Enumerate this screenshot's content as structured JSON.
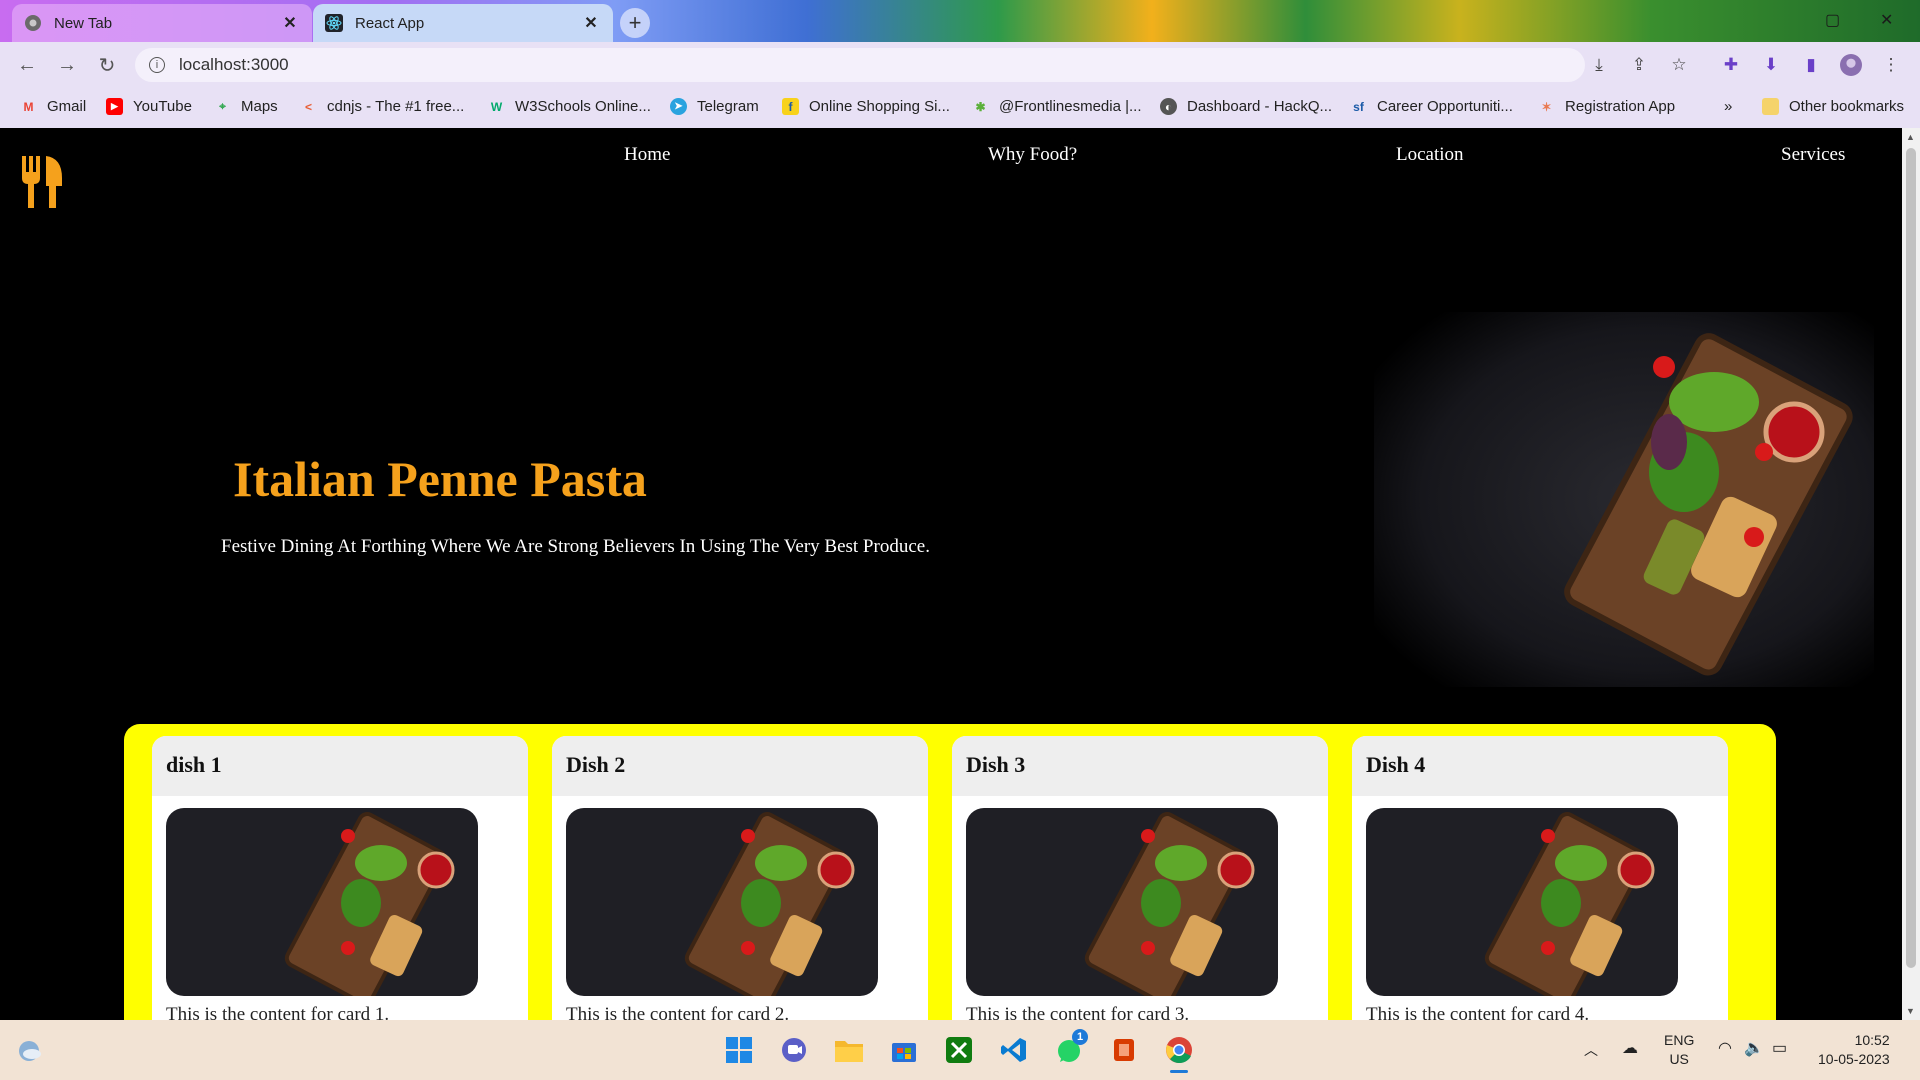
{
  "browser": {
    "tabs": [
      {
        "label": "New Tab",
        "icon": "chrome-icon",
        "active": false
      },
      {
        "label": "React App",
        "icon": "react-icon",
        "active": true
      }
    ],
    "new_tab_symbol": "+",
    "url": "localhost:3000",
    "bookmarks": [
      {
        "label": "Gmail",
        "icon": "gmail-icon",
        "color": "#ea4335"
      },
      {
        "label": "YouTube",
        "icon": "youtube-icon",
        "color": "#ff0000"
      },
      {
        "label": "Maps",
        "icon": "maps-icon",
        "color": "#34a853"
      },
      {
        "label": "cdnjs - The #1 free...",
        "icon": "cdnjs-icon",
        "color": "#e85c33"
      },
      {
        "label": "W3Schools Online...",
        "icon": "w3schools-icon",
        "color": "#04aa6d"
      },
      {
        "label": "Telegram",
        "icon": "telegram-icon",
        "color": "#2aa3df"
      },
      {
        "label": "Online Shopping Si...",
        "icon": "flipkart-icon",
        "color": "#f8d21b"
      },
      {
        "label": "@Frontlinesmedia |...",
        "icon": "frontlines-icon",
        "color": "#5bb03a"
      },
      {
        "label": "Dashboard - HackQ...",
        "icon": "hackq-icon",
        "color": "#555555"
      },
      {
        "label": "Career Opportuniti...",
        "icon": "salesforce-icon",
        "color": "#1c5ba8"
      },
      {
        "label": "Registration App",
        "icon": "registration-icon",
        "color": "#e97a52"
      }
    ],
    "bookmarks_overflow": "»",
    "other_bookmarks": "Other bookmarks"
  },
  "site": {
    "logo_icon": "fork-knife-icon",
    "accent_color": "#f5a11c",
    "nav": [
      {
        "label": "Home"
      },
      {
        "label": "Why Food?"
      },
      {
        "label": "Location"
      },
      {
        "label": "Services"
      }
    ],
    "hero": {
      "title": "Italian Penne Pasta",
      "subtitle": "Festive Dining At Forthing Where We Are Strong Believers In Using The Very Best Produce."
    },
    "cards_background": "#ffff00",
    "cards": [
      {
        "title": "dish 1",
        "content": "This is the content for card 1."
      },
      {
        "title": "Dish 2",
        "content": "This is the content for card 2."
      },
      {
        "title": "Dish 3",
        "content": "This is the content for card 3."
      },
      {
        "title": "Dish 4",
        "content": "This is the content for card 4."
      }
    ]
  },
  "taskbar": {
    "apps": [
      "windows-start-icon",
      "teams-icon",
      "file-explorer-icon",
      "microsoft-store-icon",
      "xbox-icon",
      "vscode-icon",
      "whatsapp-icon",
      "office-icon",
      "chrome-icon"
    ],
    "whatsapp_badge": "1",
    "language": "ENG",
    "region": "US",
    "time": "10:52",
    "date": "10-05-2023"
  }
}
